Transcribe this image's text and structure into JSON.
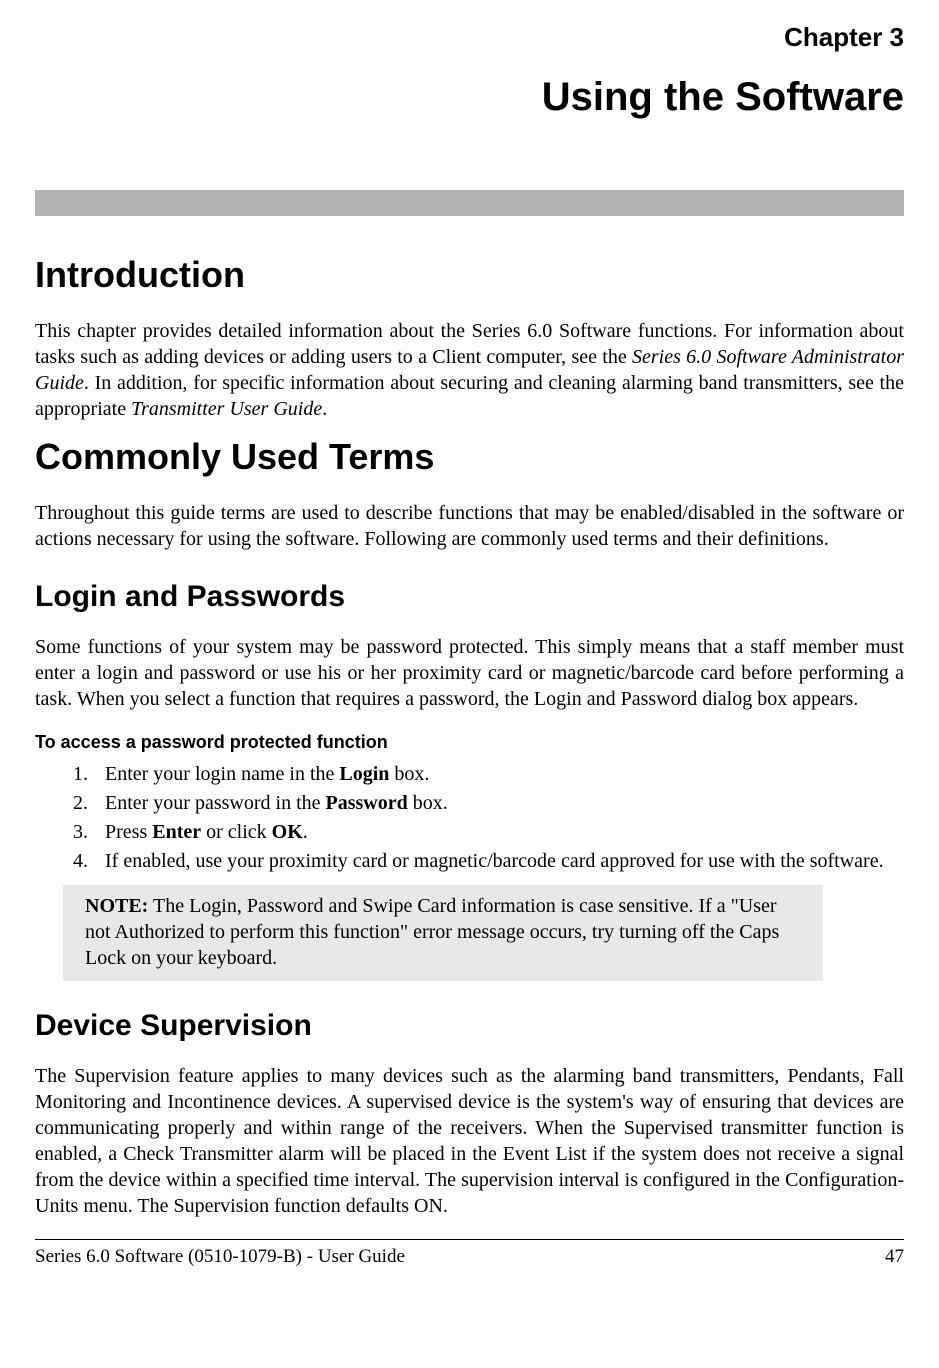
{
  "chapter": {
    "label": "Chapter 3",
    "title": "Using the Software"
  },
  "sections": {
    "intro": {
      "heading": "Introduction",
      "para": {
        "part1": "This chapter provides detailed information about the Series 6.0 Software functions. For information about tasks such as adding devices or adding users to a Client computer, see the ",
        "italic1": "Series 6.0 Software Administrator Guide",
        "part2": ". In addition, for specific information about securing and cleaning alarming band transmitters, see the appropriate ",
        "italic2": "Transmitter User Guide",
        "part3": "."
      }
    },
    "terms": {
      "heading": "Commonly Used Terms",
      "para": "Throughout this guide terms are used to describe functions that may be enabled/disabled in the software or actions necessary for using the software. Following are commonly used terms and their definitions."
    },
    "login": {
      "heading": "Login and Passwords",
      "para": "Some functions of your system may be password protected. This simply means that a staff member must enter a login and password or use his or her proximity card or magnetic/barcode card before performing a task. When you select a function that requires a password, the Login and Password dialog box appears.",
      "proc_heading": "To access a password protected function",
      "steps": {
        "s1a": "Enter your login name in the ",
        "s1b": "Login",
        "s1c": " box.",
        "s2a": "Enter your password in the ",
        "s2b": "Password",
        "s2c": " box.",
        "s3a": "Press ",
        "s3b": "Enter",
        "s3c": " or click ",
        "s3d": "OK",
        "s3e": ".",
        "s4": "If enabled, use your proximity card or magnetic/barcode card approved for use with the software."
      },
      "note": {
        "label": "NOTE:",
        "text": " The Login, Password and Swipe Card information is case sensitive. If a \"User not Authorized to perform this function\" error message occurs, try turning off the Caps Lock on your keyboard."
      }
    },
    "device": {
      "heading": "Device Supervision",
      "para": "The Supervision feature applies to many devices such as the alarming band transmitters, Pendants, Fall Monitoring and Incontinence devices. A supervised device is the system's way of ensuring that devices are communicating properly and within range of the receivers. When the Supervised transmitter function is enabled, a Check Transmitter alarm will be placed in the Event List if the system does not receive a signal from the device within a specified time interval. The supervision interval is configured in the Configuration-Units menu. The Supervision function defaults ON."
    }
  },
  "footer": {
    "left": "Series 6.0 Software (0510-1079-B) - User Guide",
    "right": "47"
  }
}
